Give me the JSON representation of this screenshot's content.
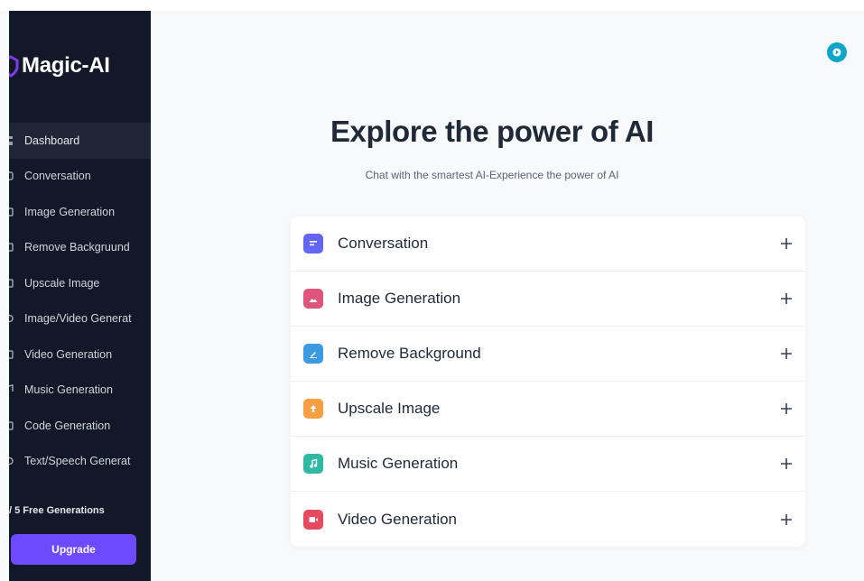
{
  "app": {
    "name": "Magic-AI",
    "brand_color": "#7c3aed"
  },
  "sidebar": {
    "items": [
      {
        "label": "Dashboard",
        "icon": "dashboard-icon",
        "active": true
      },
      {
        "label": "Conversation",
        "icon": "chat-icon",
        "active": false
      },
      {
        "label": "Image Generation",
        "icon": "image-icon",
        "active": false
      },
      {
        "label": "Remove Backgruund",
        "icon": "background-icon",
        "active": false
      },
      {
        "label": "Upscale Image",
        "icon": "upscale-icon",
        "active": false
      },
      {
        "label": "Image/Video Generat",
        "icon": "media-icon",
        "active": false
      },
      {
        "label": "Video Generation",
        "icon": "video-icon",
        "active": false
      },
      {
        "label": "Music Generation",
        "icon": "music-icon",
        "active": false
      },
      {
        "label": "Code Generation",
        "icon": "code-icon",
        "active": false
      },
      {
        "label": "Text/Speech Generat",
        "icon": "speech-icon",
        "active": false
      }
    ],
    "free_generations": "/ 5 Free Generations",
    "upgrade_label": "Upgrade",
    "upgrade_color": "#6d4aff"
  },
  "header": {
    "user_icon": "user-avatar-icon",
    "user_color": "#0ea5c6"
  },
  "main": {
    "title": "Explore the power of AI",
    "subtitle": "Chat with the smartest AI-Experience the power of AI",
    "tools": [
      {
        "label": "Conversation",
        "icon": "chat-bubble-icon",
        "color": "#6366f1"
      },
      {
        "label": "Image Generation",
        "icon": "image-icon",
        "color": "#e0557a"
      },
      {
        "label": "Remove Background",
        "icon": "edit-image-icon",
        "color": "#3b9ae1"
      },
      {
        "label": "Upscale Image",
        "icon": "upscale-arrow-icon",
        "color": "#f59e42"
      },
      {
        "label": "Music Generation",
        "icon": "music-note-icon",
        "color": "#2fb9a5"
      },
      {
        "label": "Video Generation",
        "icon": "video-icon",
        "color": "#e64a5e"
      }
    ]
  }
}
